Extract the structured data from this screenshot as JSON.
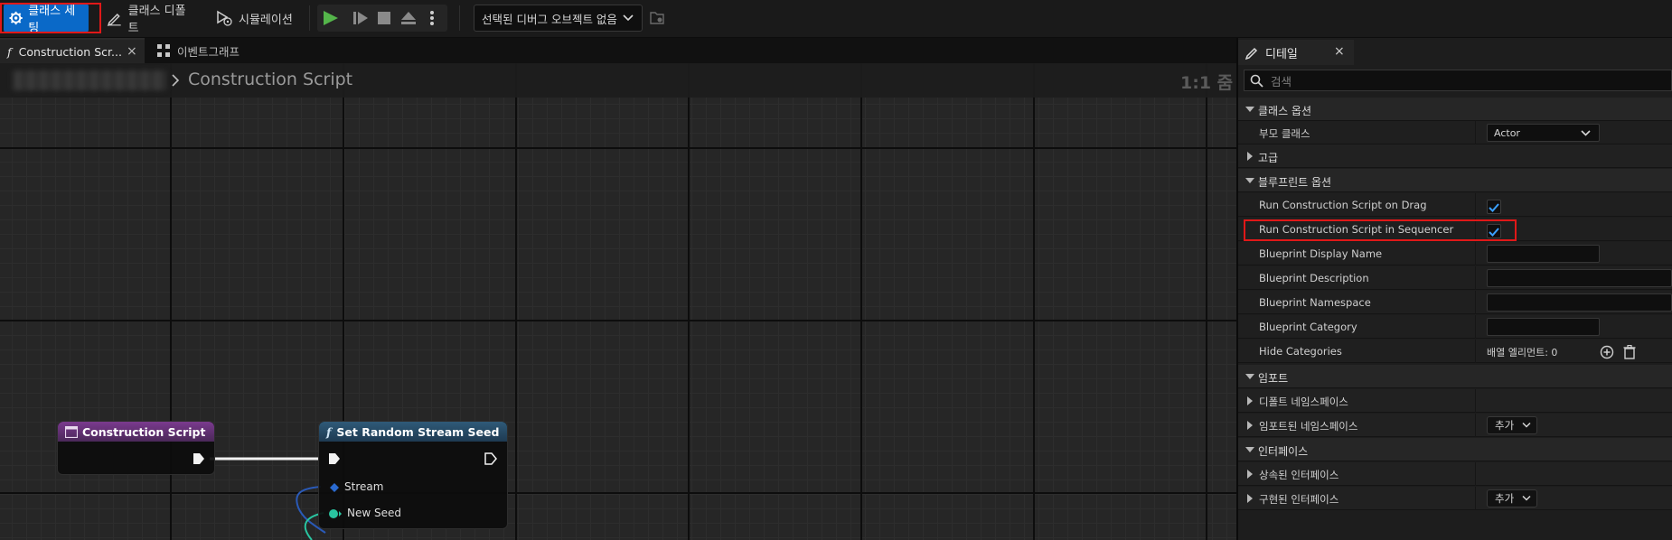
{
  "toolbar": {
    "class_settings_label": "클래스 세팅",
    "class_defaults_label": "클래스 디폴트",
    "simulation_label": "시뮬레이션",
    "debug_object_select": "선택된 디버그 오브젝트 없음"
  },
  "tabs": [
    {
      "label": "Construction Scr...",
      "close": "×"
    },
    {
      "label": "이벤트그래프"
    }
  ],
  "graph": {
    "breadcrumb_title": "Construction Script",
    "zoom_label": "1:1 줌",
    "nodes": {
      "construction_script": {
        "title": "Construction Script"
      },
      "set_random_stream_seed": {
        "title": "Set Random Stream Seed",
        "pins": [
          "Stream",
          "New Seed"
        ]
      }
    }
  },
  "details": {
    "tab_label": "디테일",
    "close": "×",
    "search_placeholder": "검색",
    "class_options": {
      "label": "클래스 옵션",
      "parent_class_label": "부모 클래스",
      "parent_class_value": "Actor",
      "advanced_label": "고급"
    },
    "blueprint_options": {
      "label": "블루프린트 옵션",
      "run_on_drag": {
        "label": "Run Construction Script on Drag",
        "checked": true
      },
      "run_in_sequencer": {
        "label": "Run Construction Script in Sequencer",
        "checked": true
      },
      "display_name_label": "Blueprint Display Name",
      "description_label": "Blueprint Description",
      "namespace_label": "Blueprint Namespace",
      "category_label": "Blueprint Category",
      "hide_categories_label": "Hide Categories",
      "hide_categories_value": "배열 엘리먼트: 0"
    },
    "imports": {
      "label": "임포트",
      "default_namespaces_label": "디폴트 네임스페이스",
      "imported_namespaces_label": "임포트된 네임스페이스",
      "add_label": "추가"
    },
    "interfaces": {
      "label": "인터페이스",
      "inherited_label": "상속된 인터페이스",
      "implemented_label": "구현된 인터페이스",
      "add_label": "추가"
    }
  }
}
